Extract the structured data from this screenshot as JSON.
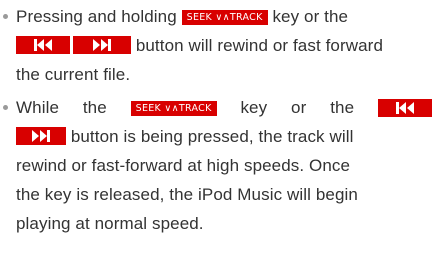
{
  "colors": {
    "key_bg": "#d80000",
    "text": "#333333",
    "bullet": "#9a9a9a"
  },
  "icons": {
    "rewind": "skip-back-icon",
    "forward": "skip-forward-icon"
  },
  "bullets": [
    {
      "line1_pre": "Pressing and holding",
      "key_label": "SEEK ∨∧TRACK",
      "line1_post": "key or the",
      "line2_post": "button will rewind or fast forward",
      "line3": "the current file."
    },
    {
      "line1_w1": "While",
      "line1_w2": "the",
      "key_label": "SEEK ∨∧TRACK",
      "line1_w3": "key",
      "line1_w4": "or",
      "line1_w5": "the",
      "line2_post": "button is being pressed, the track will",
      "line3": "rewind or fast-forward at high speeds. Once",
      "line4": "the key is released, the iPod Music will begin",
      "line5": "playing at normal speed."
    }
  ]
}
